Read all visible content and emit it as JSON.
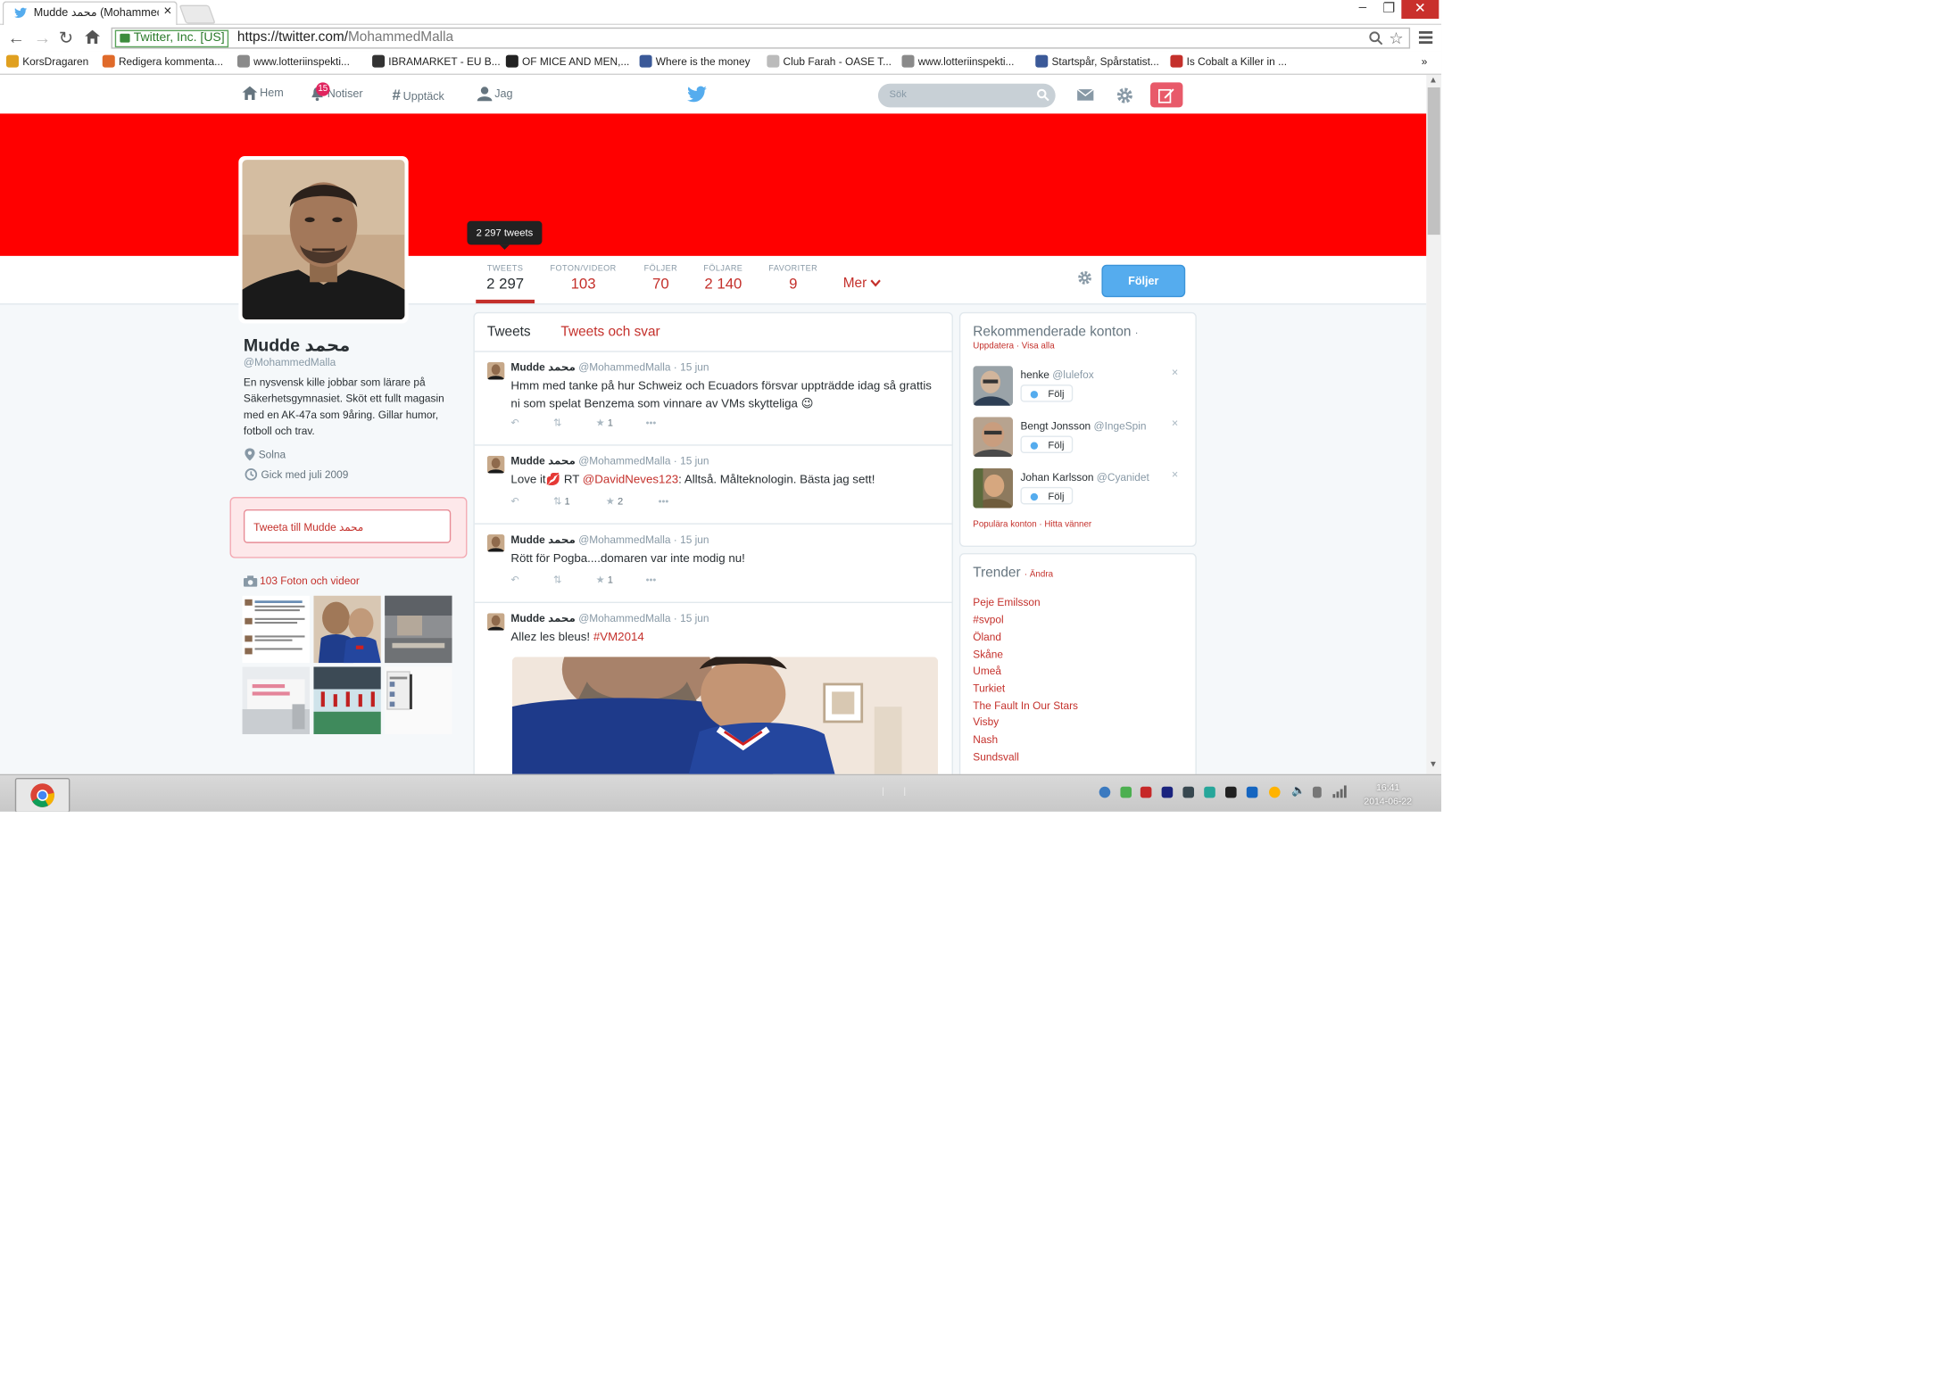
{
  "browser": {
    "tab_title": "Mudde محمد (Mohammed",
    "tab_close": "×",
    "ssl_label": "Twitter, Inc. [US]",
    "url_host": "https://twitter.com/",
    "url_path": "MohammedMalla",
    "window_minimize": "–",
    "window_restore": "❐",
    "window_close": "✕"
  },
  "bookmarks": [
    {
      "label": "KorsDragaren",
      "color": "#e0a020"
    },
    {
      "label": "Redigera kommenta...",
      "color": "#e06a2a"
    },
    {
      "label": "www.lotteriinspekti...",
      "color": "#8a8a8a"
    },
    {
      "label": "IBRAMARKET - EU B...",
      "color": "#333333"
    },
    {
      "label": "OF MICE AND MEN,...",
      "color": "#222222"
    },
    {
      "label": "Where is the money",
      "color": "#3b5998"
    },
    {
      "label": "Club Farah - OASE T...",
      "color": "#bbbbbb"
    },
    {
      "label": "www.lotteriinspekti...",
      "color": "#8a8a8a"
    },
    {
      "label": "Startspår, Spårstatist...",
      "color": "#3b5998"
    },
    {
      "label": "Is Cobalt a Killer in ...",
      "color": "#c4302b"
    }
  ],
  "bookmarks_more": "»",
  "nav": {
    "home": "Hem",
    "notifications": "Notiser",
    "notifications_badge": "15",
    "discover": "Upptäck",
    "me": "Jag",
    "search_placeholder": "Sök"
  },
  "profile": {
    "name": "Mudde محمد",
    "handle": "@MohammedMalla",
    "bio": "En nysvensk kille jobbar som lärare på Säkerhetsgymnasiet. Sköt ett fullt magasin med en AK-47a som 9åring. Gillar humor, fotboll och trav.",
    "location": "Solna",
    "joined": "Gick med juli 2009",
    "tweet_to": "Tweeta till Mudde محمد",
    "photos_label": "103 Foton och videor",
    "tooltip": "2 297 tweets",
    "follow_button": "Följer",
    "more": "Mer"
  },
  "stats": [
    {
      "label": "TWEETS",
      "value": "2 297"
    },
    {
      "label": "FOTON/VIDEOR",
      "value": "103"
    },
    {
      "label": "FÖLJER",
      "value": "70"
    },
    {
      "label": "FÖLJARE",
      "value": "2 140"
    },
    {
      "label": "FAVORITER",
      "value": "9"
    }
  ],
  "timeline": {
    "tab_tweets": "Tweets",
    "tab_replies": "Tweets och svar",
    "tweets": [
      {
        "name": "Mudde محمد",
        "meta": "@MohammedMalla · 15 jun",
        "text": "Hmm med tanke på hur Schweiz och Ecuadors försvar uppträdde idag så grattis ni som spelat Benzema som vinnare av VMs skytteliga 😉",
        "retweets": "",
        "favorites": "1"
      },
      {
        "name": "Mudde محمد",
        "meta": "@MohammedMalla · 15 jun",
        "text_before": "Love it💋 RT ",
        "mention": "@DavidNeves123",
        "text_after": ": Alltså. Målteknologin. Bästa jag sett!",
        "retweets": "1",
        "favorites": "2"
      },
      {
        "name": "Mudde محمد",
        "meta": "@MohammedMalla · 15 jun",
        "text": "Rött för Pogba....domaren var inte modig nu!",
        "retweets": "",
        "favorites": "1"
      },
      {
        "name": "Mudde محمد",
        "meta": "@MohammedMalla · 15 jun",
        "text_before": "Allez les bleus! ",
        "hashtag": "#VM2014"
      }
    ]
  },
  "who_to_follow": {
    "title": "Rekommenderade konton",
    "dot": "·",
    "refresh": "Uppdatera",
    "view_all": "Visa alla",
    "follow_label": "Följ",
    "dismiss": "×",
    "accounts": [
      {
        "name": "henke",
        "handle": "@lulefox"
      },
      {
        "name": "Bengt Jonsson",
        "handle": "@IngeSpin"
      },
      {
        "name": "Johan Karlsson",
        "handle": "@Cyanidet"
      }
    ],
    "footer": "Populära konton · Hitta vänner"
  },
  "trends": {
    "title": "Trender",
    "change": "· Ändra",
    "items": [
      "Peje Emilsson",
      "#svpol",
      "Öland",
      "Skåne",
      "Umeå",
      "Turkiet",
      "The Fault In Our Stars",
      "Visby",
      "Nash",
      "Sundsvall"
    ]
  },
  "taskbar": {
    "time": "16:41",
    "date": "2014-06-22"
  },
  "colors": {
    "banner": "#ff0000",
    "link": "#c4302b",
    "follow_button": "#55acee"
  }
}
